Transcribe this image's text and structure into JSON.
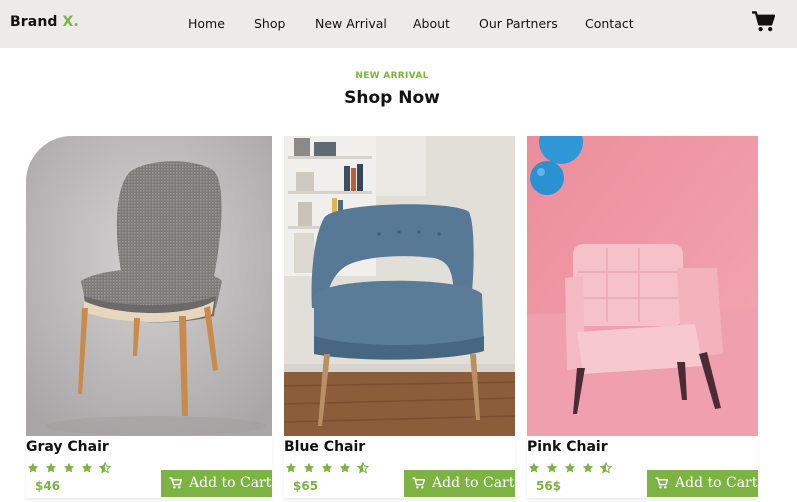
{
  "brand": {
    "name": "Brand",
    "accent": "X."
  },
  "nav": {
    "links": [
      "Home",
      "Shop",
      "New Arrival",
      "About",
      "Our Partners",
      "Contact"
    ],
    "cart_icon": "shopping-cart-icon"
  },
  "section": {
    "eyebrow": "NEW ARRIVAL",
    "title": "Shop Now"
  },
  "products": [
    {
      "name": "Gray Chair",
      "price": "$46",
      "rating": 4.5,
      "button": "Add to Cart",
      "image": "gray-chair-photo"
    },
    {
      "name": "Blue Chair",
      "price": "$65",
      "rating": 4.5,
      "button": "Add to Cart",
      "image": "blue-chair-photo"
    },
    {
      "name": "Pink Chair",
      "price": "56$",
      "rating": 4.5,
      "button": "Add to Cart",
      "image": "pink-chair-photo"
    }
  ],
  "colors": {
    "accent": "#7cb342",
    "navbar": "#ecebe9",
    "text": "#111111"
  }
}
